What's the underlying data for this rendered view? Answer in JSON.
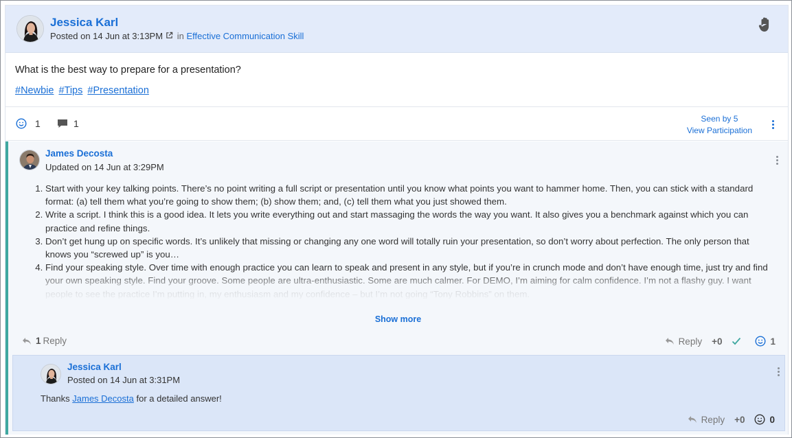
{
  "post": {
    "author": "Jessica Karl",
    "posted_prefix": "Posted on 14 Jun at 3:13PM",
    "in_label": "in",
    "channel": "Effective Communication Skill",
    "question": "What is the best way to prepare for a presentation?",
    "tags": [
      "#Newbie",
      "#Tips",
      "#Presentation"
    ],
    "reaction_count": "1",
    "comment_count": "1",
    "seen_by": "Seen by 5",
    "view_participation": "View Participation",
    "icons": [
      "smiley-icon",
      "comment-icon",
      "raise-hand-icon",
      "external-link-icon",
      "more-icon"
    ]
  },
  "answer": {
    "author": "James Decosta",
    "updated": "Updated on 14 Jun at 3:29PM",
    "items": [
      "Start with your key talking points. There’s no point writing a full script or presentation until you know what points you want to hammer home. Then, you can stick with a standard format: (a) tell them what you’re going to show them; (b) show them; and, (c) tell them what you just showed them.",
      "Write a script. I think this is a good idea. It lets you write everything out and start massaging the words the way you want. It also gives you a benchmark against which you can practice and refine things.",
      "Don’t get hung up on specific words. It’s unlikely that missing or changing any one word will totally ruin your presentation, so don’t worry about perfection. The only person that knows you “screwed up” is you…",
      "Find your speaking style. Over time with enough practice you can learn to speak and present in any style, but if you’re in crunch mode and don’t have enough time, just try and find your own speaking style. Find your groove. Some people are ultra-enthusiastic. Some are much calmer. For DEMO, I’m aiming for calm confidence. I’m not a flashy guy. I want people to see the practice I’m putting in, my enthusiasm and my confidence – but I’m not going “Tony Robbins” on them."
    ],
    "show_more": "Show more",
    "reply_count": "1",
    "reply_count_label": "Reply",
    "reply_label": "Reply",
    "vote": "+0",
    "reaction_count": "1",
    "accent_color": "#3fa8a0"
  },
  "reply": {
    "author": "Jessica Karl",
    "posted": "Posted on 14 Jun at 3:31PM",
    "text_before": "Thanks",
    "mention": "James Decosta",
    "text_after": "for a detailed answer!",
    "reply_label": "Reply",
    "vote": "+0",
    "reaction_count": "0"
  },
  "colors": {
    "link": "#1a6fd6",
    "header_bg": "#e3ebfa",
    "reply_bg": "#dbe6f8"
  }
}
